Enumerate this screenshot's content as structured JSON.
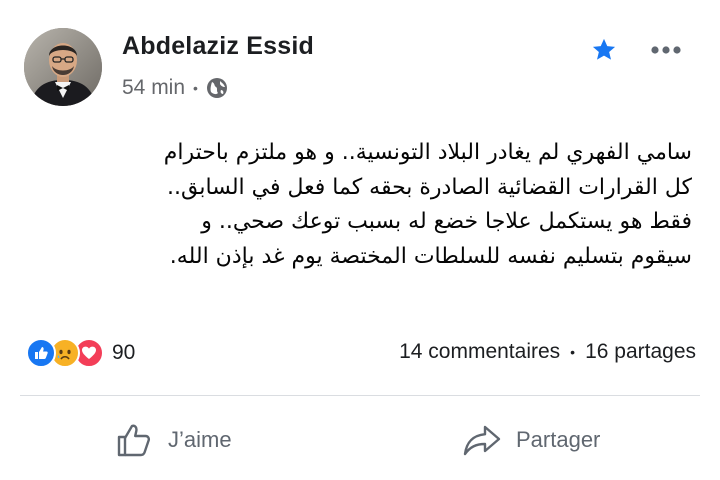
{
  "post": {
    "author": "Abdelaziz Essid",
    "time": "54 min",
    "audience_icon": "globe-icon",
    "body_lines": [
      "سامي الفهري لم يغادر البلاد التونسية.. و هو ملتزم باحترام",
      "كل القرارات القضائية الصادرة بحقه كما فعل في السابق..",
      "فقط هو يستكمل علاجا خضع له بسبب توعك صحي.. و",
      "سيقوم بتسليم نفسه للسلطات المختصة يوم غد بإذن الله."
    ]
  },
  "reactions": {
    "icons": [
      "like-reaction-icon",
      "sad-reaction-icon",
      "love-reaction-icon"
    ],
    "count": "90"
  },
  "stats": {
    "comments": "14 commentaires",
    "shares": "16 partages",
    "separator": "•"
  },
  "actions": {
    "like_label": "J’aime",
    "share_label": "Partager"
  },
  "colors": {
    "like_blue": "#1877f2",
    "love_red": "#f33e58",
    "sad_yellow": "#f7b125",
    "star_blue": "#1877f2",
    "secondary_text": "#65676b"
  }
}
